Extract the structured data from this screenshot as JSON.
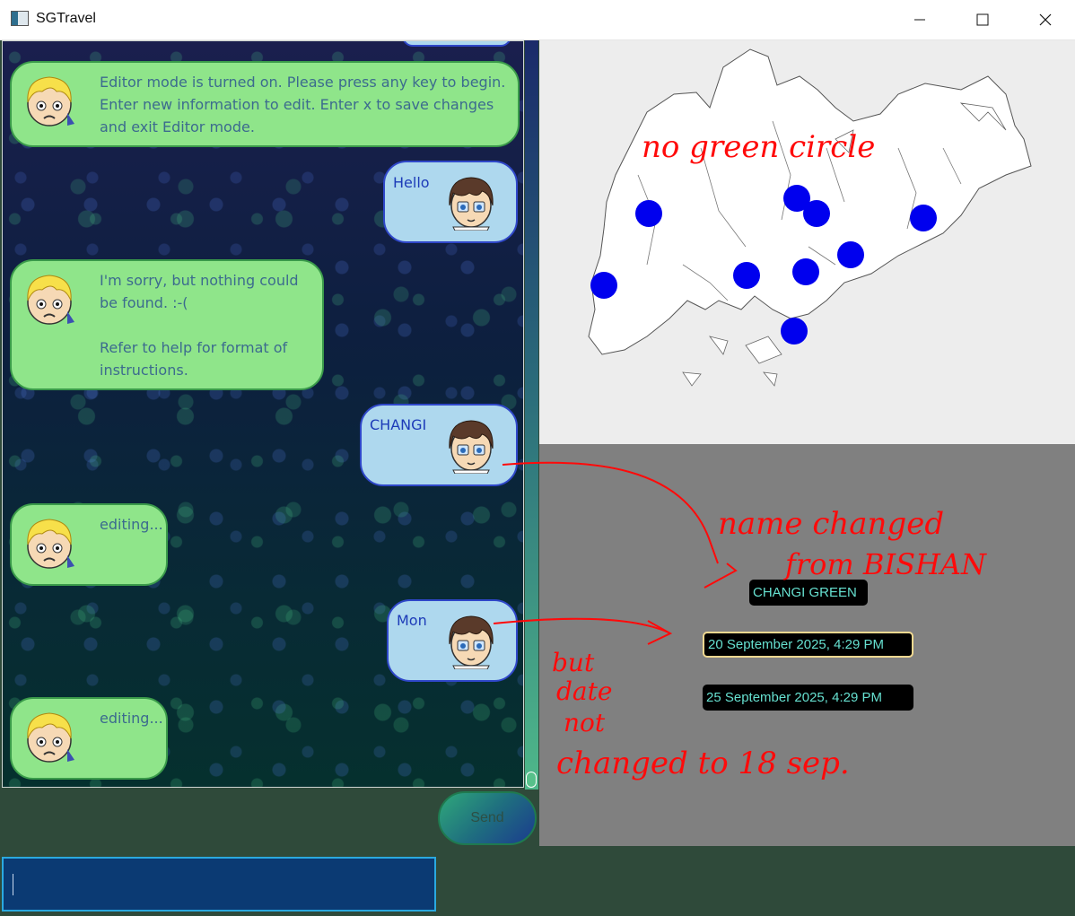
{
  "window": {
    "title": "SGTravel",
    "controls": [
      "minimize",
      "maximize",
      "close"
    ]
  },
  "chat": {
    "messages": [
      {
        "sender": "bot",
        "text": "Editor mode is turned on. Please press any key to begin.\nEnter new information to edit. Enter x to save changes\nand exit Editor mode."
      },
      {
        "sender": "user",
        "text": "Hello"
      },
      {
        "sender": "bot",
        "text": "I'm sorry, but nothing could\nbe found. :-(\n\nRefer to help for format of\ninstructions."
      },
      {
        "sender": "user",
        "text": "CHANGI"
      },
      {
        "sender": "bot",
        "text": "editing..."
      },
      {
        "sender": "user",
        "text": "Mon"
      },
      {
        "sender": "bot",
        "text": "editing..."
      }
    ]
  },
  "input": {
    "send_label": "Send",
    "value": ""
  },
  "map": {
    "marker_color": "#0000ee",
    "marker_count": 10
  },
  "details": {
    "name": "CHANGI GREEN",
    "start_date": "20 September 2025, 4:29 PM",
    "end_date": "25 September 2025, 4:29 PM"
  },
  "annotations": {
    "note_map": "no green circle",
    "note_name_1": "name changed",
    "note_name_2": "from BISHAN",
    "note_date_1": "but",
    "note_date_2": "date",
    "note_date_3": "not",
    "note_date_4": "changed to 18 sep.",
    "color": "#ff0a0a"
  }
}
